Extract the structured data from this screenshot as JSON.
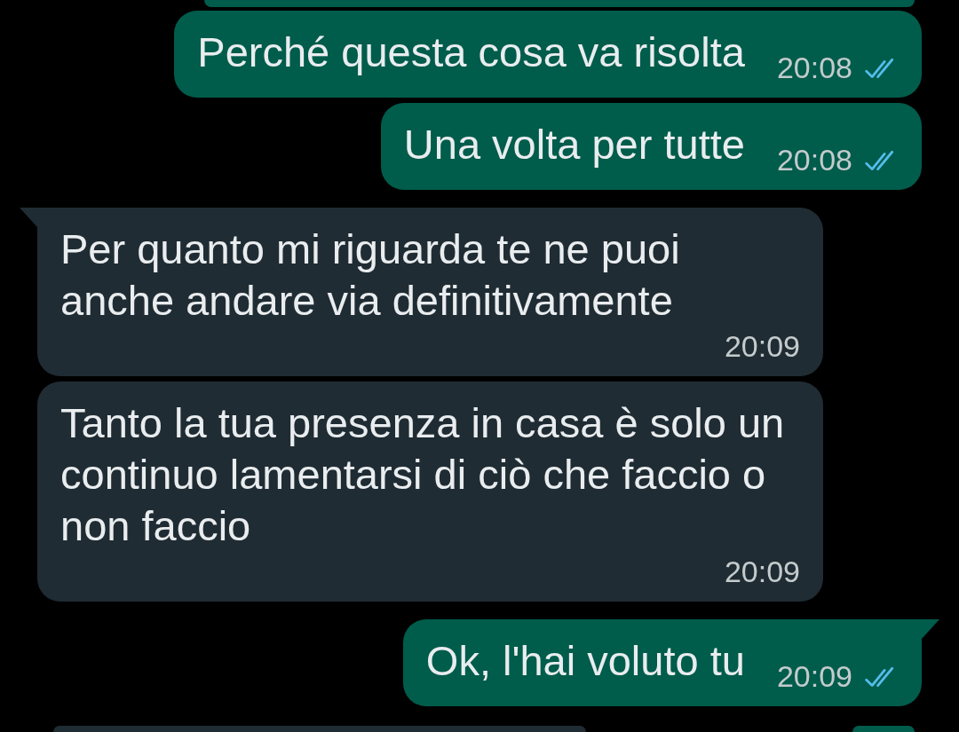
{
  "messages": [
    {
      "kind": "outgoing",
      "tail": false,
      "text": "Perché questa cosa va risolta",
      "time": "20:08",
      "read": true
    },
    {
      "kind": "outgoing",
      "tail": false,
      "text": "Una volta per tutte",
      "time": "20:08",
      "read": true
    },
    {
      "kind": "incoming",
      "tail": true,
      "text": "Per quanto mi riguarda te ne puoi anche andare via definitivamente",
      "time": "20:09"
    },
    {
      "kind": "incoming",
      "tail": false,
      "text": "Tanto la tua presenza in casa è solo un continuo lamentarsi di ciò che faccio o non faccio",
      "time": "20:09"
    },
    {
      "kind": "outgoing",
      "tail": true,
      "text": "Ok, l'hai voluto tu",
      "time": "20:09",
      "read": true
    }
  ]
}
